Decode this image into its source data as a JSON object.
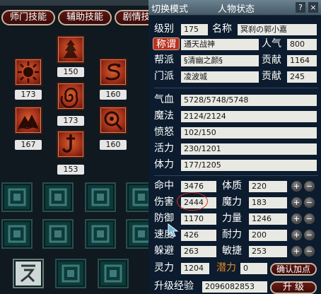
{
  "left_panel": {
    "tabs": {
      "shimen": "师门技能",
      "fuzhu": "辅助技能",
      "juqing": "剧情技"
    },
    "skills": [
      {
        "icon": "pagoda-icon",
        "level": "150"
      },
      {
        "icon": "sun-mask-icon",
        "level": "173"
      },
      {
        "icon": "serpent-icon",
        "level": "160"
      },
      {
        "icon": "vortex-icon",
        "level": "173"
      },
      {
        "icon": "mountain-icon",
        "level": "167"
      },
      {
        "icon": "ring-orb-icon",
        "level": "160"
      },
      {
        "icon": "hook-icon",
        "level": "153"
      }
    ]
  },
  "status": {
    "mode_label": "切换模式",
    "title": "人物状态",
    "help": "?",
    "close": "×",
    "level_label": "级别",
    "level": "175",
    "name_label": "名称",
    "name": "冥刹の郭小嘉",
    "honor_label": "称谓",
    "honor": "通天战神",
    "popularity_label": "人气",
    "popularity": "800",
    "guild_label": "帮派",
    "guild": "§清幽之颜§",
    "contrib_label": "贡献",
    "guild_contrib": "1164",
    "sect_label": "门派",
    "sect": "凌波城",
    "sect_contrib_label": "贡献",
    "sect_contrib": "245",
    "hp_label": "气血",
    "hp": "5728/5748/5748",
    "mp_label": "魔法",
    "mp": "2124/2124",
    "rage_label": "愤怒",
    "rage": "102/150",
    "vitality_label": "活力",
    "vitality": "230/1201",
    "stamina_label": "体力",
    "stamina": "177/1205",
    "accuracy_label": "命中",
    "accuracy": "3476",
    "physique_label": "体质",
    "physique": "220",
    "damage_label": "伤害",
    "damage": "2444",
    "magic_label": "魔力",
    "magic": "183",
    "defense_label": "防御",
    "defense": "1170",
    "strength_label": "力量",
    "strength": "1246",
    "speed_label": "速度",
    "speed": "426",
    "endurance_label": "耐力",
    "endurance": "200",
    "dodge_label": "躲避",
    "dodge": "263",
    "agility_label": "敏捷",
    "agility": "253",
    "spirit_label": "灵力",
    "spirit": "1204",
    "potential_label": "潜力",
    "potential": "0",
    "confirm_points": "确认加点",
    "exp_label": "升级经验",
    "exp": "2096082853",
    "upgrade": "升 级",
    "plus": "+",
    "minus": "−"
  },
  "colors": {
    "accent_red": "#b8321f",
    "potential_orange": "#e0862a",
    "panel_bg": "#0c1c2e"
  }
}
